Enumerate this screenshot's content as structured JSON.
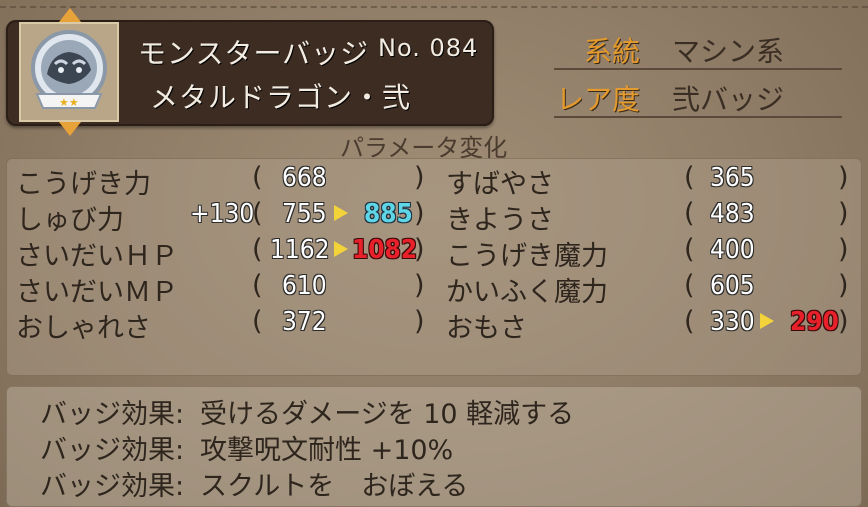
{
  "header": {
    "category": "モンスターバッジ",
    "number": "No. 084",
    "name": "メタルドラゴン・弐"
  },
  "info": {
    "type_label": "系統",
    "type_value": "マシン系",
    "rarity_label": "レア度",
    "rarity_value": "弐バッジ"
  },
  "param_title": "パラメータ変化",
  "stats_left": [
    {
      "label": "こうげき力",
      "bonus": "",
      "current": "668",
      "new": ""
    },
    {
      "label": "しゅび力",
      "bonus": "+130",
      "current": "755",
      "new": "885"
    },
    {
      "label": "さいだいＨＰ",
      "bonus": "",
      "current": "1162",
      "new": "1082"
    },
    {
      "label": "さいだいＭＰ",
      "bonus": "",
      "current": "610",
      "new": ""
    },
    {
      "label": "おしゃれさ",
      "bonus": "",
      "current": "372",
      "new": ""
    }
  ],
  "stats_right": [
    {
      "label": "すばやさ",
      "current": "365",
      "new": ""
    },
    {
      "label": "きようさ",
      "current": "483",
      "new": ""
    },
    {
      "label": "こうげき魔力",
      "current": "400",
      "new": ""
    },
    {
      "label": "かいふく魔力",
      "current": "605",
      "new": ""
    },
    {
      "label": "おもさ",
      "current": "330",
      "new": "290"
    }
  ],
  "effects": [
    {
      "label": "バッジ効果:",
      "text": "受けるダメージを 10 軽減する"
    },
    {
      "label": "バッジ効果:",
      "text": "攻撃呪文耐性 +10%"
    },
    {
      "label": "バッジ効果:",
      "text": "スクルトを　おぼえる"
    }
  ],
  "icons": {
    "badge": "metal-dragon-badge-icon",
    "scroll_up": "up-arrow-icon",
    "scroll_down": "down-arrow-icon",
    "change_arrow": "yellow-triangle-icon"
  },
  "colors": {
    "increase": "#5fd6e6",
    "decrease": "#e8202a",
    "label_orange": "#e49a2c"
  }
}
